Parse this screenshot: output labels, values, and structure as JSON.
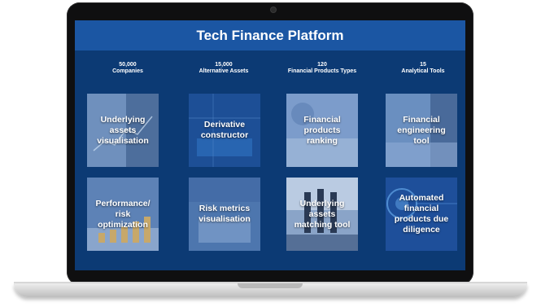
{
  "header": {
    "title": "Tech Finance Platform"
  },
  "stats": [
    {
      "value": "50,000",
      "label": "Companies"
    },
    {
      "value": "15,000",
      "label": "Alternative Assets"
    },
    {
      "value": "120",
      "label": "Financial Products Types"
    },
    {
      "value": "15",
      "label": "Analytical Tools"
    }
  ],
  "tiles": [
    {
      "label": "Underlying assets visualisation"
    },
    {
      "label": "Derivative constructor"
    },
    {
      "label": "Financial products ranking"
    },
    {
      "label": "Financial engineering tool"
    },
    {
      "label": "Performance/ risk optimization"
    },
    {
      "label": "Risk metrics visualisation"
    },
    {
      "label": "Underlying assets matching tool"
    },
    {
      "label": "Automated financial products due diligence"
    }
  ],
  "colors": {
    "screen_bg": "#0c3a74",
    "title_bar": "#1b56a3",
    "tile_bg": "#5d86b9"
  }
}
